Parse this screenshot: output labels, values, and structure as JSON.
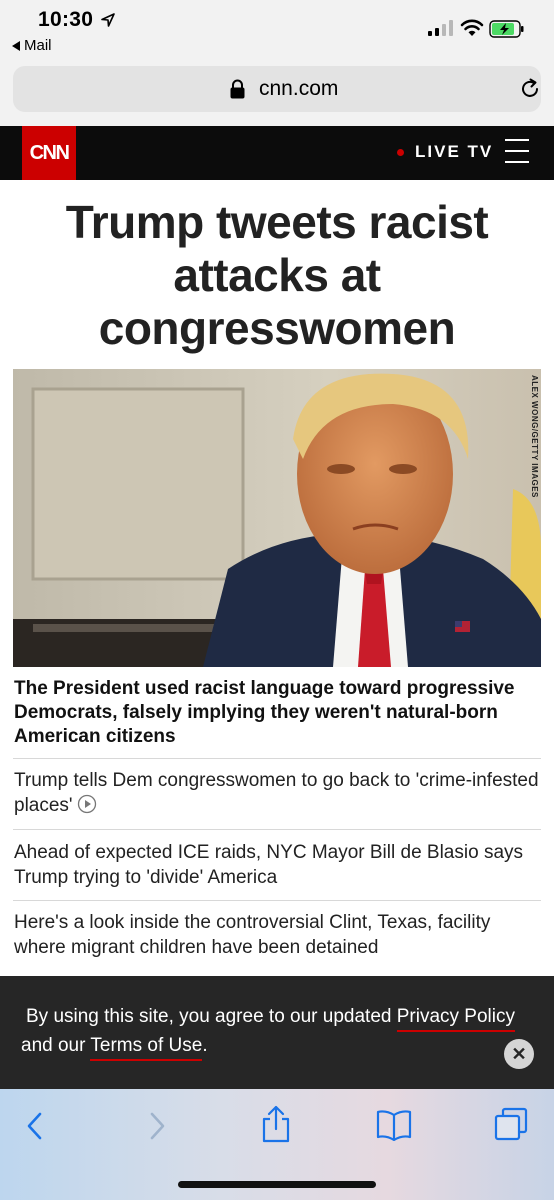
{
  "status_bar": {
    "time": "10:30",
    "back_app": "Mail",
    "icons": [
      "location-arrow-icon",
      "signal-icon",
      "wifi-icon",
      "battery-charging-icon"
    ]
  },
  "browser": {
    "url": "cnn.com"
  },
  "site_header": {
    "logo_text": "CNN",
    "live_label": "LIVE TV",
    "brand_color": "#cc0000"
  },
  "main": {
    "headline": "Trump tweets racist attacks at congresswomen",
    "photo_credit": "ALEX WONG/GETTY IMAGES",
    "lead_summary": "The President used racist language toward progressive Democrats, falsely implying they weren't natural-born American citizens",
    "articles": [
      {
        "text": "Trump tells Dem congresswomen to go back to 'crime-infested places'",
        "has_video": true
      },
      {
        "text": "Ahead of expected ICE raids, NYC Mayor Bill de Blasio says Trump trying to 'divide' America",
        "has_video": false
      },
      {
        "text": "Here's a look inside the controversial Clint, Texas, facility where migrant children have been detained",
        "has_video": false
      }
    ]
  },
  "cookie_banner": {
    "text_before": "By using this site, you agree to our updated ",
    "privacy_link": "Privacy Policy",
    "text_middle": " and our ",
    "terms_link": "Terms of Use",
    "text_after": ".",
    "close_symbol": "✕"
  },
  "toolbar": {
    "icons": [
      "back-icon",
      "forward-icon",
      "share-icon",
      "bookmarks-icon",
      "tabs-icon"
    ]
  }
}
